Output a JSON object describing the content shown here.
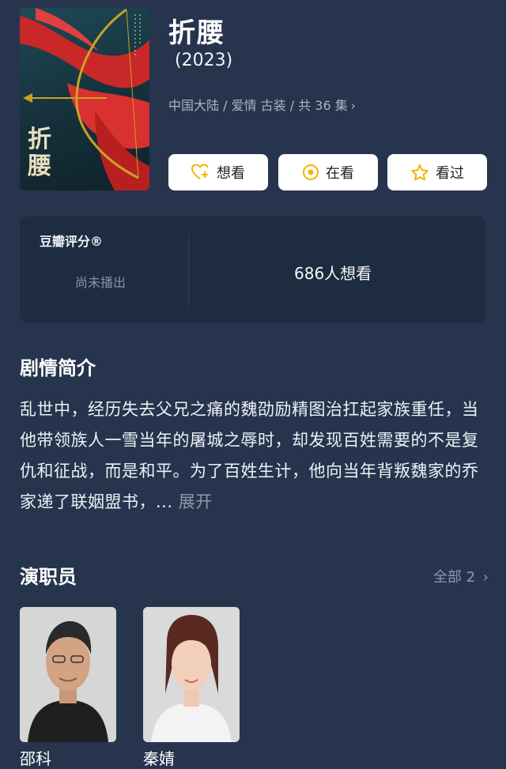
{
  "movie": {
    "title": "折腰",
    "year": "(2023)",
    "meta": "中国大陆 / 爱情 古装 / 共 36 集",
    "poster": {
      "title_text": "折腰",
      "colors": {
        "bg": "#1b3a44",
        "ribbon": "#d42a2a",
        "gold": "#c9a227"
      }
    }
  },
  "actions": {
    "want_label": "想看",
    "watching_label": "在看",
    "watched_label": "看过"
  },
  "rating": {
    "source": "豆瓣评分®",
    "status": "尚未播出",
    "want_count": "686人想看"
  },
  "synopsis": {
    "heading": "剧情简介",
    "text": "乱世中，经历失去父兄之痛的魏劭励精图治扛起家族重任，当他带领族人一雪当年的屠城之辱时，却发现百姓需要的不是复仇和征战，而是和平。为了百姓生计，他向当年背叛魏家的乔家递了联姻盟书，... ",
    "expand_label": "展开"
  },
  "cast": {
    "heading": "演职员",
    "all_label": "全部 2",
    "members": [
      {
        "name": "邵科"
      },
      {
        "name": "秦婧"
      }
    ]
  },
  "colors": {
    "background": "#26354d",
    "card": "#1d2c40",
    "accent_gold": "#f3b500"
  }
}
